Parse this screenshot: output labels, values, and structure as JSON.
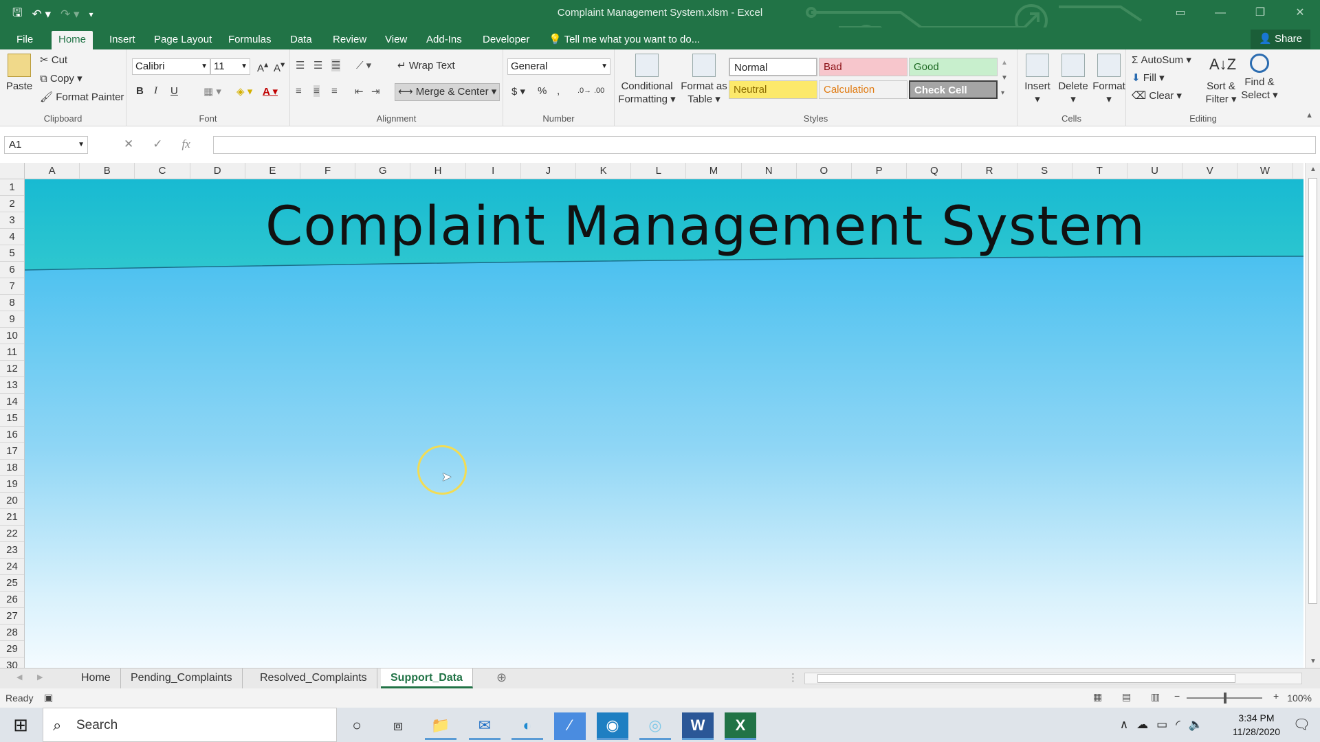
{
  "window": {
    "title": "Complaint Management System.xlsm - Excel"
  },
  "ribbon_tabs": [
    {
      "label": "File"
    },
    {
      "label": "Home"
    },
    {
      "label": "Insert"
    },
    {
      "label": "Page Layout"
    },
    {
      "label": "Formulas"
    },
    {
      "label": "Data"
    },
    {
      "label": "Review"
    },
    {
      "label": "View"
    },
    {
      "label": "Add-Ins"
    },
    {
      "label": "Developer"
    }
  ],
  "tell_me": "Tell me what you want to do...",
  "share_label": "Share",
  "clipboard": {
    "paste": "Paste",
    "cut": "Cut",
    "copy": "Copy",
    "format_painter": "Format Painter",
    "group": "Clipboard"
  },
  "font": {
    "name": "Calibri",
    "size": "11",
    "group": "Font",
    "bold": "B",
    "italic": "I",
    "underline": "U"
  },
  "alignment": {
    "wrap_text": "Wrap Text",
    "merge_center": "Merge & Center",
    "group": "Alignment"
  },
  "number": {
    "format": "General",
    "group": "Number",
    "currency": "$",
    "percent": "%",
    "comma": ","
  },
  "styles": {
    "conditional_line1": "Conditional",
    "conditional_line2": "Formatting",
    "format_table_line1": "Format as",
    "format_table_line2": "Table",
    "cells": [
      {
        "label": "Normal"
      },
      {
        "label": "Bad"
      },
      {
        "label": "Good"
      },
      {
        "label": "Neutral"
      },
      {
        "label": "Calculation"
      },
      {
        "label": "Check Cell"
      }
    ],
    "group": "Styles"
  },
  "cells_group": {
    "insert": "Insert",
    "delete": "Delete",
    "format": "Format",
    "group": "Cells"
  },
  "editing": {
    "autosum": "AutoSum",
    "fill": "Fill",
    "clear": "Clear",
    "sort_line1": "Sort &",
    "sort_line2": "Filter",
    "find_line1": "Find &",
    "find_line2": "Select",
    "group": "Editing"
  },
  "formula_bar": {
    "name_box": "A1",
    "fx": "fx",
    "value": ""
  },
  "columns": [
    "A",
    "B",
    "C",
    "D",
    "E",
    "F",
    "G",
    "H",
    "I",
    "J",
    "K",
    "L",
    "M",
    "N",
    "O",
    "P",
    "Q",
    "R",
    "S",
    "T",
    "U",
    "V",
    "W"
  ],
  "rows": [
    "1",
    "2",
    "3",
    "4",
    "5",
    "6",
    "7",
    "8",
    "9",
    "10",
    "11",
    "12",
    "13",
    "14",
    "15",
    "16",
    "17",
    "18",
    "19",
    "20",
    "21",
    "22",
    "23",
    "24",
    "25",
    "26",
    "27",
    "28",
    "29",
    "30"
  ],
  "banner": {
    "title": "Complaint Management System",
    "color": "#1dc0d6"
  },
  "sheet_tabs": [
    {
      "label": "Home",
      "active": false
    },
    {
      "label": "Pending_Complaints",
      "active": false
    },
    {
      "label": "Resolved_Complaints",
      "active": false
    },
    {
      "label": "Support_Data",
      "active": true
    }
  ],
  "status": {
    "ready": "Ready",
    "zoom": "100%"
  },
  "taskbar": {
    "search_placeholder": "Search",
    "time": "3:34 PM",
    "date": "11/28/2020"
  },
  "colors": {
    "excel_green": "#217346",
    "sheet_gradient_top": "#2eb6ec"
  }
}
